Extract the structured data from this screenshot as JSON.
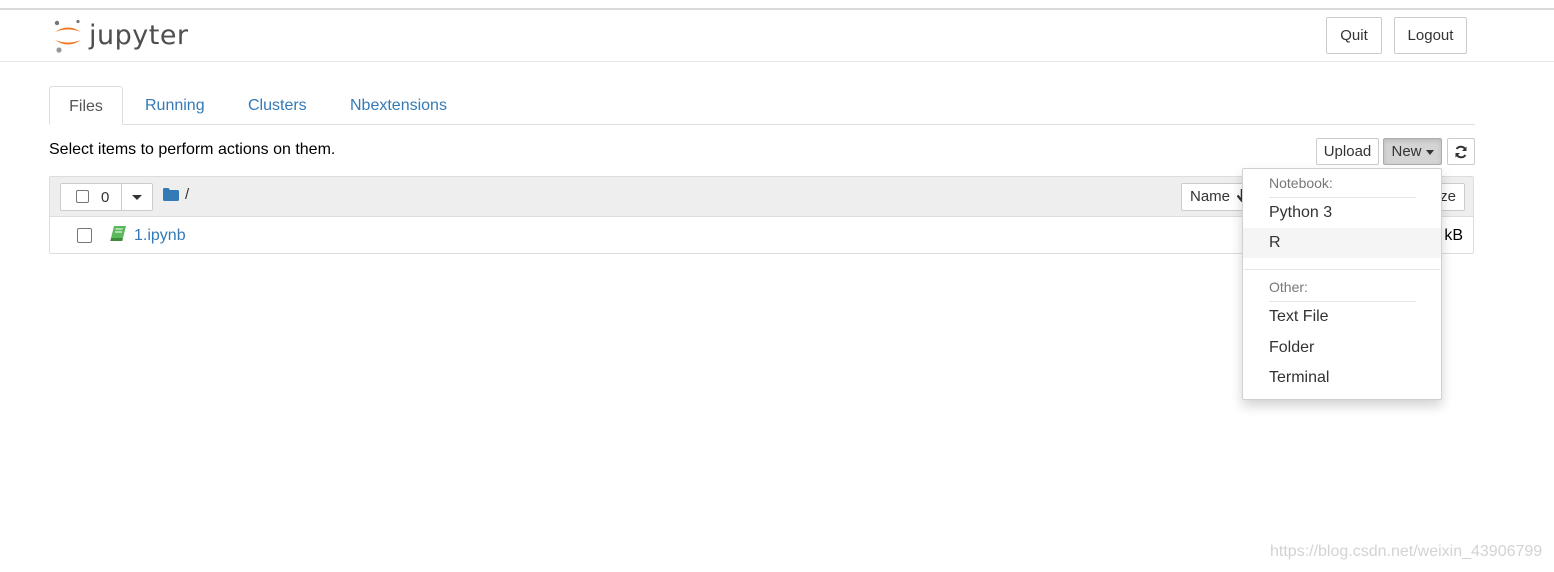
{
  "header": {
    "logo_text": "jupyter",
    "quit_label": "Quit",
    "logout_label": "Logout"
  },
  "tabs": [
    {
      "label": "Files",
      "active": true
    },
    {
      "label": "Running",
      "active": false
    },
    {
      "label": "Clusters",
      "active": false
    },
    {
      "label": "Nbextensions",
      "active": false
    }
  ],
  "toolbar": {
    "hint": "Select items to perform actions on them.",
    "upload_label": "Upload",
    "new_label": "New"
  },
  "file_list": {
    "selected_count": "0",
    "breadcrumb": "/",
    "name_column": "Name",
    "size_column_partial": "ze",
    "rows": [
      {
        "name": "1.ipynb",
        "size_partial": "kB"
      }
    ]
  },
  "new_menu": {
    "notebook_header": "Notebook:",
    "notebook_items": [
      "Python 3",
      "R"
    ],
    "other_header": "Other:",
    "other_items": [
      "Text File",
      "Folder",
      "Terminal"
    ]
  },
  "watermark": "https://blog.csdn.net/weixin_43906799",
  "colors": {
    "link": "#337ab7",
    "logo_orange": "#f37726",
    "notebook_icon": "#5cb85c",
    "folder_icon": "#337ab7"
  },
  "icons": [
    "jupyter-logo-icon",
    "refresh-icon",
    "folder-icon",
    "notebook-icon",
    "sort-down-arrow-icon",
    "caret-down-icon"
  ]
}
